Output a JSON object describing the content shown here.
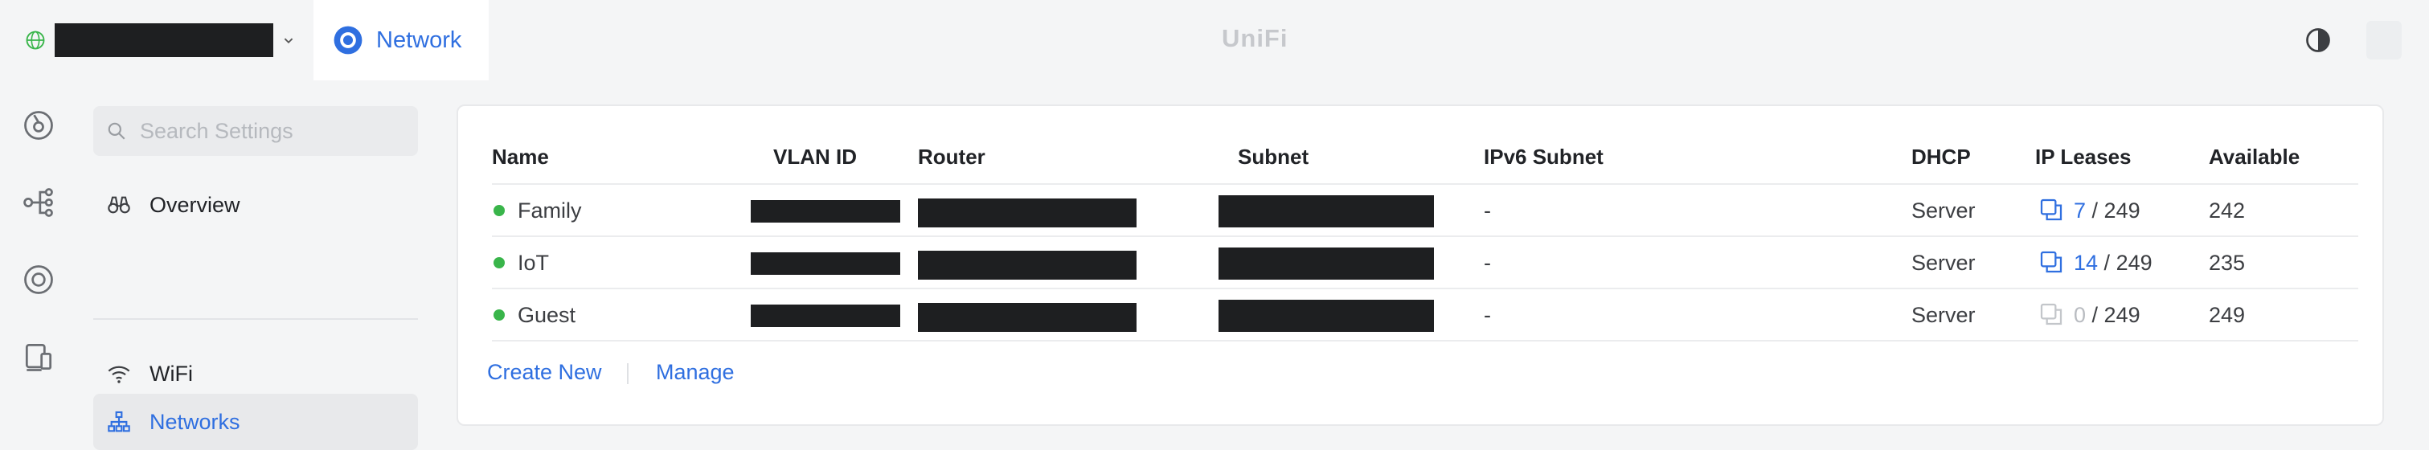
{
  "app": {
    "tab_label": "Network",
    "brand": "UniFi"
  },
  "colors": {
    "accent": "#2f6fe0",
    "status_online": "#39b54a",
    "redaction": "#1e1f21"
  },
  "icons": {
    "site": "globe-icon",
    "app": "network-app-icon",
    "theme": "theme-toggle-icon"
  },
  "search": {
    "placeholder": "Search Settings"
  },
  "sidebar": {
    "items": [
      {
        "label": "Overview",
        "icon": "binoculars-icon"
      },
      {
        "label": "WiFi",
        "icon": "wifi-icon"
      },
      {
        "label": "Networks",
        "icon": "networks-icon",
        "active": true
      }
    ]
  },
  "table": {
    "columns": [
      "Name",
      "VLAN ID",
      "Router",
      "Subnet",
      "IPv6 Subnet",
      "DHCP",
      "IP Leases",
      "Available"
    ],
    "rows": [
      {
        "name": "Family",
        "ipv6": "-",
        "dhcp": "Server",
        "leases_used": "7",
        "leases_total": "249",
        "available": "242"
      },
      {
        "name": "IoT",
        "ipv6": "-",
        "dhcp": "Server",
        "leases_used": "14",
        "leases_total": "249",
        "available": "235"
      },
      {
        "name": "Guest",
        "ipv6": "-",
        "dhcp": "Server",
        "leases_used": "0",
        "leases_total": "249",
        "available": "249"
      }
    ]
  },
  "actions": {
    "create_new": "Create New",
    "manage": "Manage"
  }
}
